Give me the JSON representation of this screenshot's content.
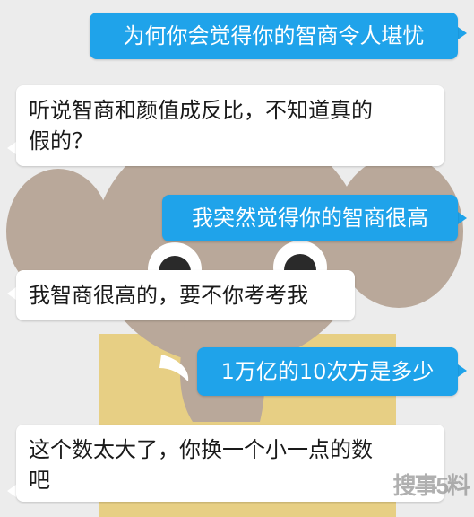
{
  "chat": {
    "messages": [
      {
        "side": "out",
        "text": "为何你会觉得你的智商令人堪忧"
      },
      {
        "side": "in",
        "text": "听说智商和颜值成反比，不知道真的\n假的？"
      },
      {
        "side": "out",
        "text": "我突然觉得你的智商很高"
      },
      {
        "side": "in",
        "text": "我智商很高的，要不你考考我"
      },
      {
        "side": "out",
        "text": "1万亿的10次方是多少"
      },
      {
        "side": "in",
        "text": "这个数太大了，你换一个小一点的数\n吧"
      }
    ]
  },
  "watermark": {
    "text": "搜事5料"
  },
  "colors": {
    "outgoing_bubble": "#1fa3ea",
    "incoming_bubble": "#ffffff",
    "background": "#ececec",
    "mascot_body": "#b9a89a",
    "mascot_box": "#e7cf84"
  },
  "background": {
    "mascot": "elephant-mascot-with-box"
  }
}
